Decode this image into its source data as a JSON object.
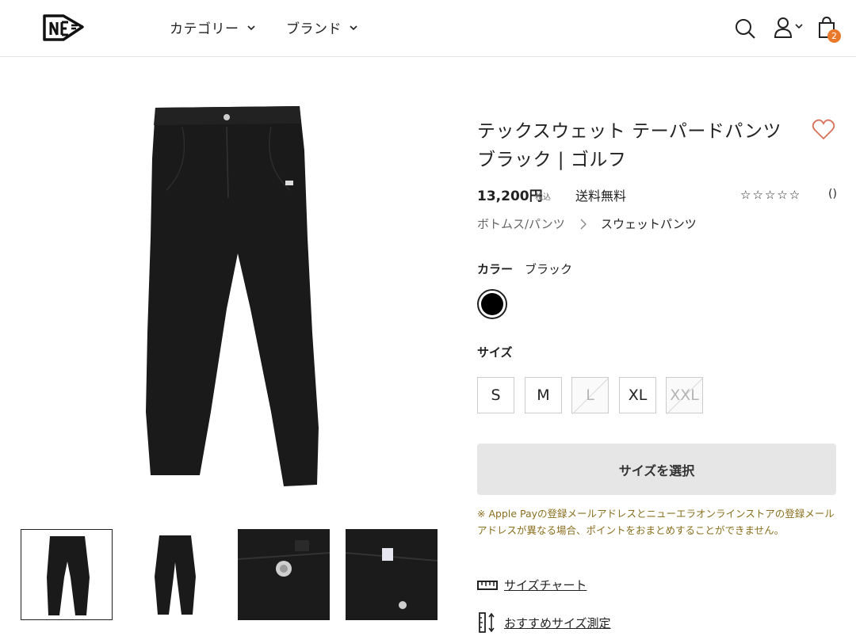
{
  "header": {
    "nav": [
      {
        "label": "カテゴリー"
      },
      {
        "label": "ブランド"
      }
    ],
    "cart_count": "2",
    "icons": [
      "search-icon",
      "account-icon",
      "chevron-down-icon",
      "cart-icon"
    ]
  },
  "product": {
    "title_line1": "テックスウェット テーパードパンツ",
    "title_line2": "ブラック | ゴルフ",
    "price": "13,200円",
    "tax_label": "税込",
    "shipping": "送料無料",
    "rating_stars": "☆☆☆☆☆",
    "review_count": "()",
    "breadcrumb": [
      "ボトムス/パンツ",
      "スウェットパンツ"
    ],
    "color_label": "カラー",
    "color_value": "ブラック",
    "swatch_color": "#000000",
    "size_label": "サイズ",
    "sizes": [
      {
        "label": "S",
        "available": true
      },
      {
        "label": "M",
        "available": true
      },
      {
        "label": "L",
        "available": false
      },
      {
        "label": "XL",
        "available": true
      },
      {
        "label": "XXL",
        "available": false
      }
    ],
    "cta_label": "サイズを選択",
    "note": "※ Apple Payの登録メールアドレスとニューエラオンラインストアの登録メールアドレスが異なる場合、ポイントをおまとめすることができません。",
    "links": [
      {
        "label": "サイズチャート",
        "icon": "ruler-icon"
      },
      {
        "label": "おすすめサイズ測定",
        "icon": "measure-icon"
      }
    ]
  },
  "colors": {
    "badge": "#e8792b",
    "favorite": "#d9705a",
    "note_text": "#8a6f1e",
    "cta_bg": "#e6e6e6"
  }
}
